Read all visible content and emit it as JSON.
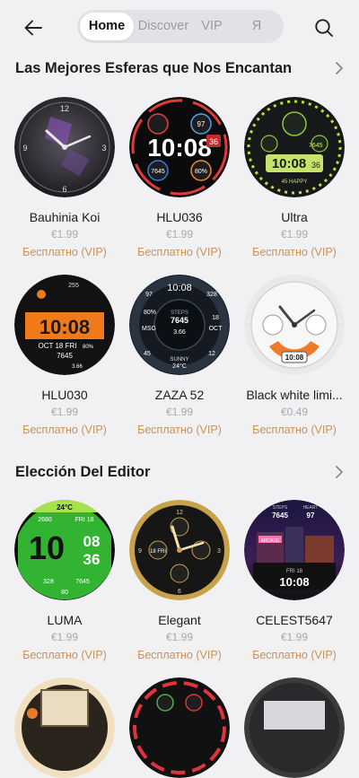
{
  "tabs": [
    {
      "label": "Home"
    },
    {
      "label": "Discover"
    },
    {
      "label": "VIP"
    },
    {
      "label": "Я"
    }
  ],
  "sections": [
    {
      "title": "Las Mejores Esferas que Nos Encantan"
    },
    {
      "title": "Elección Del Editor"
    }
  ],
  "cards": [
    {
      "name": "Bauhinia Koi",
      "price": "€1.99",
      "badge": "Бесплатно (VIP)"
    },
    {
      "name": "HLU036",
      "price": "€1.99",
      "badge": "Бесплатно (VIP)"
    },
    {
      "name": "Ultra",
      "price": "€1.99",
      "badge": "Бесплатно (VIP)"
    },
    {
      "name": "HLU030",
      "price": "€1.99",
      "badge": "Бесплатно (VIP)"
    },
    {
      "name": "ZAZA 52",
      "price": "€1.99",
      "badge": "Бесплатно (VIP)"
    },
    {
      "name": "Black white limi...",
      "price": "€0.49",
      "badge": "Бесплатно (VIP)"
    },
    {
      "name": "LUMA",
      "price": "€1.99",
      "badge": "Бесплатно (VIP)"
    },
    {
      "name": "Elegant",
      "price": "€1.99",
      "badge": "Бесплатно (VIP)"
    },
    {
      "name": "CELEST5647",
      "price": "€1.99",
      "badge": "Бесплатно (VIP)"
    }
  ],
  "faces": {
    "hlu036": {
      "time": "10:08",
      "top": "97",
      "left": "7645",
      "right": "80%",
      "side": "36"
    },
    "ultra": {
      "stat": "7645",
      "time": "10:08",
      "sec": "36",
      "happy": "45 HAPPY"
    },
    "hlu030": {
      "time": "10:08",
      "date": "OCT 18 FRI",
      "steps": "7645",
      "km": "3.66",
      "battery": "80%",
      "top": "255"
    },
    "zaza": {
      "time": "10:08",
      "steps": "7645",
      "dist": "3.66",
      "pct": "80%",
      "msg": "MSG",
      "temp": "24°C",
      "w1": "328",
      "w2": "97",
      "w3": "45",
      "w4": "12",
      "sunny": "SUNNY",
      "oct": "OCT",
      "n18": "18"
    },
    "bw": {
      "time": "10:08"
    },
    "luma": {
      "temp": "24°C",
      "steps": "2680",
      "day": "FRI 18",
      "d1": "10",
      "d2": "08",
      "d3": "36",
      "s1": "328",
      "s2": "7645",
      "s3": "80"
    },
    "elegant": {
      "n1": "12",
      "n2": "3",
      "n3": "9",
      "n4": "6",
      "small": "18 FRI"
    },
    "celest": {
      "steps": "STEPS",
      "heart": "HEART",
      "v1": "7645",
      "v2": "97",
      "time": "10:08",
      "date": "FRI 18",
      "arcade": "ARCADE"
    }
  },
  "colors": {
    "accent": "#c8925a",
    "tabBg": "#e2e2e6",
    "page": "#f1f1f3"
  },
  "icons": [
    "arrow-left-icon",
    "search-icon",
    "chevron-right-icon"
  ]
}
